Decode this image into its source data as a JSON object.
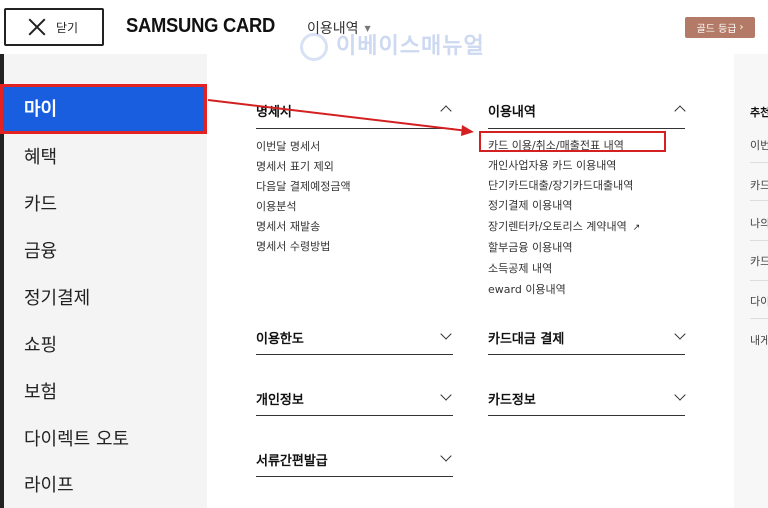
{
  "header": {
    "close_label": "닫기",
    "brand": "SAMSUNG CARD",
    "menu_label": "이용내역",
    "grade_label": "골드 등급",
    "watermark": "이베이스매뉴얼"
  },
  "sidebar": {
    "items": [
      {
        "label": "마이",
        "active": true
      },
      {
        "label": "혜택"
      },
      {
        "label": "카드"
      },
      {
        "label": "금융"
      },
      {
        "label": "정기결제"
      },
      {
        "label": "쇼핑"
      },
      {
        "label": "보험"
      },
      {
        "label": "다이렉트 오토"
      },
      {
        "label": "라이프"
      }
    ]
  },
  "sections": {
    "statement": {
      "title": "명세서",
      "items": [
        "이번달 명세서",
        "명세서 표기 제외",
        "다음달 결제예정금액",
        "이용분석",
        "명세서 재발송",
        "명세서 수령방법"
      ]
    },
    "usage": {
      "title": "이용내역",
      "items": [
        "카드 이용/취소/매출전표 내역",
        "개인사업자용 카드 이용내역",
        "단기카드대출/장기카드대출내역",
        "정기결제 이용내역",
        "장기렌터카/오토리스 계약내역",
        "할부금융 이용내역",
        "소득공제 내역",
        "eward 이용내역"
      ]
    },
    "limit": {
      "title": "이용한도"
    },
    "payment": {
      "title": "카드대금 결제"
    },
    "personal": {
      "title": "개인정보"
    },
    "cardinfo": {
      "title": "카드정보"
    },
    "docs": {
      "title": "서류간편발급"
    }
  },
  "right_panel": {
    "items": [
      "추천",
      "이번",
      "카드",
      "나의",
      "카드",
      "다이",
      "내게"
    ]
  },
  "colors": {
    "active_nav": "#1a5ee0",
    "annotation": "#d32020",
    "grade_badge": "#b37b67"
  }
}
